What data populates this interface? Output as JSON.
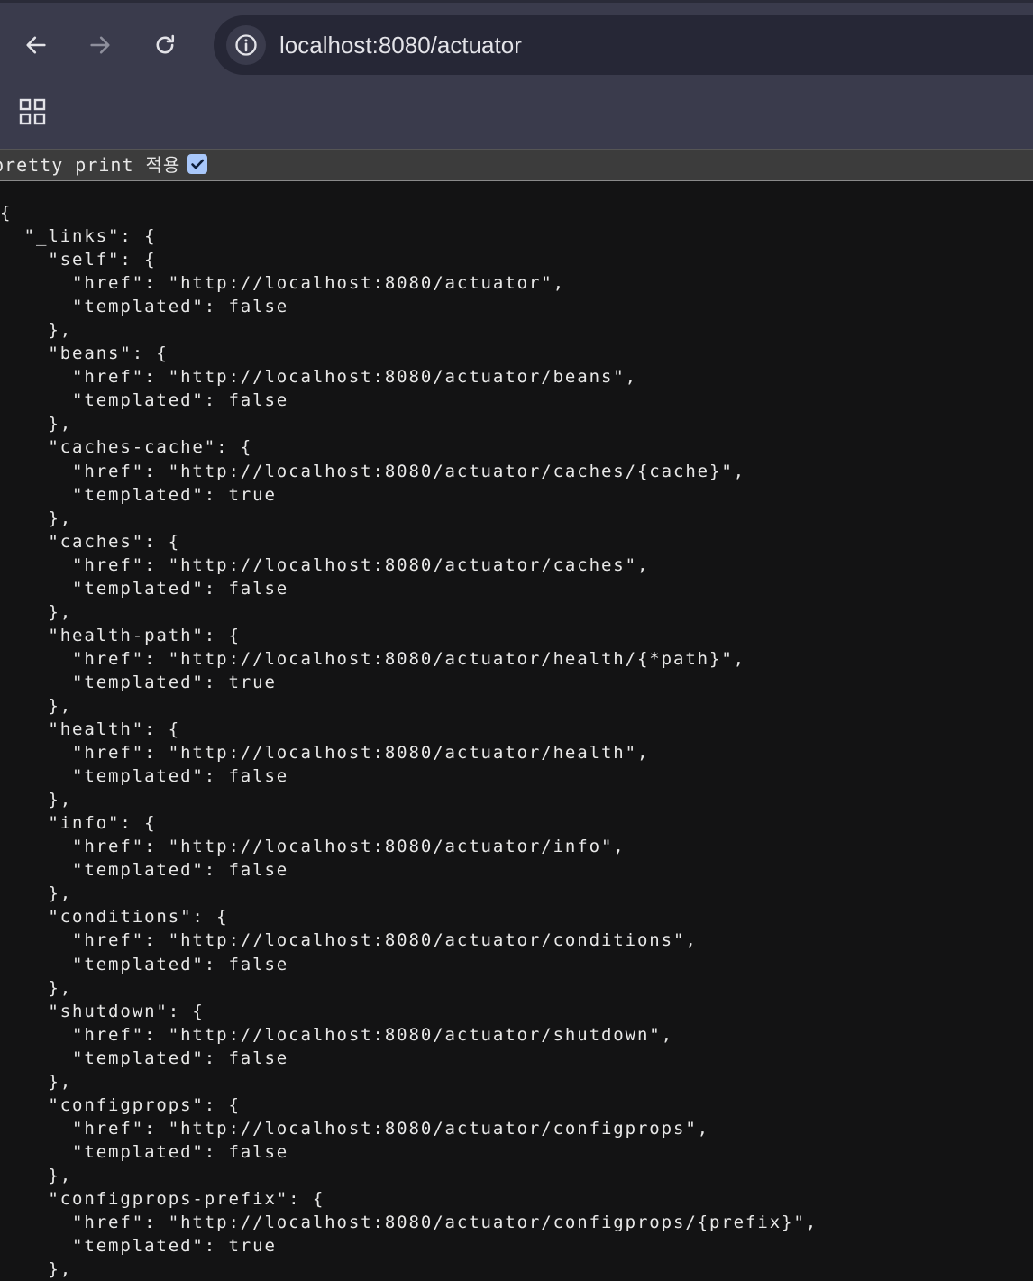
{
  "browser": {
    "url": "localhost:8080/actuator",
    "back_icon": "arrow-left-icon",
    "forward_icon": "arrow-right-icon",
    "reload_icon": "reload-icon",
    "site_info_icon": "info-circle-icon",
    "apps_icon": "apps-grid-icon"
  },
  "pretty_print": {
    "label": "pretty print 적용",
    "checked": true
  },
  "json_lines": [
    "{",
    "  \"_links\": {",
    "    \"self\": {",
    "      \"href\": \"http://localhost:8080/actuator\",",
    "      \"templated\": false",
    "    },",
    "    \"beans\": {",
    "      \"href\": \"http://localhost:8080/actuator/beans\",",
    "      \"templated\": false",
    "    },",
    "    \"caches-cache\": {",
    "      \"href\": \"http://localhost:8080/actuator/caches/{cache}\",",
    "      \"templated\": true",
    "    },",
    "    \"caches\": {",
    "      \"href\": \"http://localhost:8080/actuator/caches\",",
    "      \"templated\": false",
    "    },",
    "    \"health-path\": {",
    "      \"href\": \"http://localhost:8080/actuator/health/{*path}\",",
    "      \"templated\": true",
    "    },",
    "    \"health\": {",
    "      \"href\": \"http://localhost:8080/actuator/health\",",
    "      \"templated\": false",
    "    },",
    "    \"info\": {",
    "      \"href\": \"http://localhost:8080/actuator/info\",",
    "      \"templated\": false",
    "    },",
    "    \"conditions\": {",
    "      \"href\": \"http://localhost:8080/actuator/conditions\",",
    "      \"templated\": false",
    "    },",
    "    \"shutdown\": {",
    "      \"href\": \"http://localhost:8080/actuator/shutdown\",",
    "      \"templated\": false",
    "    },",
    "    \"configprops\": {",
    "      \"href\": \"http://localhost:8080/actuator/configprops\",",
    "      \"templated\": false",
    "    },",
    "    \"configprops-prefix\": {",
    "      \"href\": \"http://localhost:8080/actuator/configprops/{prefix}\",",
    "      \"templated\": true",
    "    },"
  ]
}
